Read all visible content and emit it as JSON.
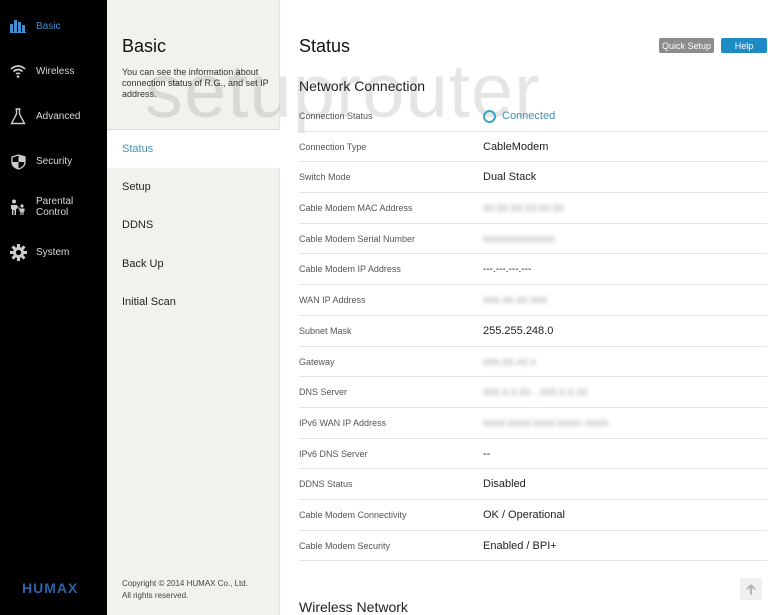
{
  "nav": {
    "items": [
      {
        "label": "Basic",
        "icon": "bar-chart-icon",
        "active": true
      },
      {
        "label": "Wireless",
        "icon": "wifi-icon",
        "active": false
      },
      {
        "label": "Advanced",
        "icon": "flask-icon",
        "active": false
      },
      {
        "label": "Security",
        "icon": "shield-icon",
        "active": false
      },
      {
        "label": "Parental Control",
        "icon": "family-icon",
        "active": false
      },
      {
        "label": "System",
        "icon": "gear-icon",
        "active": false
      }
    ],
    "logo": "HUMAX",
    "active_color": "#3d8fd1",
    "logo_color": "#2a63a8"
  },
  "sub": {
    "title": "Basic",
    "description": "You can see the information about connection status of R.G., and set IP address.",
    "items": [
      {
        "label": "Status",
        "active": true
      },
      {
        "label": "Setup",
        "active": false
      },
      {
        "label": "DDNS",
        "active": false
      },
      {
        "label": "Back Up",
        "active": false
      },
      {
        "label": "Initial Scan",
        "active": false
      }
    ],
    "copyright_line1": "Copyright © 2014 HUMAX Co., Ltd.",
    "copyright_line2": "All rights reserved."
  },
  "main": {
    "title": "Status",
    "quick_setup_label": "Quick Setup",
    "help_label": "Help",
    "watermark": "setuprouter",
    "network_section_title": "Network Connection",
    "wireless_section_title": "Wireless Network",
    "rows": [
      {
        "label": "Connection Status",
        "value": "Connected",
        "type": "status"
      },
      {
        "label": "Connection Type",
        "value": "CableModem"
      },
      {
        "label": "Switch Mode",
        "value": "Dual Stack"
      },
      {
        "label": "Cable Modem MAC Address",
        "value": "xx:xx:xx:xx:xx:xx",
        "blurred": true
      },
      {
        "label": "Cable Modem Serial Number",
        "value": "xxxxxxxxxxxxx",
        "blurred": true
      },
      {
        "label": "Cable Modem IP Address",
        "value": "---.---.---.---"
      },
      {
        "label": "WAN IP Address",
        "value": "xxx.xx.xx.xxx",
        "blurred": true
      },
      {
        "label": "Subnet Mask",
        "value": "255.255.248.0"
      },
      {
        "label": "Gateway",
        "value": "xxx.xx.xx.x",
        "blurred": true
      },
      {
        "label": "DNS Server",
        "value": "xxx.x.x.xx , xxx.x.x.xx",
        "blurred": true
      },
      {
        "label": "IPv6 WAN IP Address",
        "value": "xxxx:xxxx:xxxx:xxxx::xxxx",
        "blurred": true
      },
      {
        "label": "IPv6 DNS Server",
        "value": "--"
      },
      {
        "label": "DDNS Status",
        "value": "Disabled"
      },
      {
        "label": "Cable Modem Connectivity",
        "value": "OK / Operational"
      },
      {
        "label": "Cable Modem Security",
        "value": "Enabled / BPI+"
      }
    ],
    "status_color": "#3aa6c4",
    "help_color": "#1f8bc4"
  }
}
